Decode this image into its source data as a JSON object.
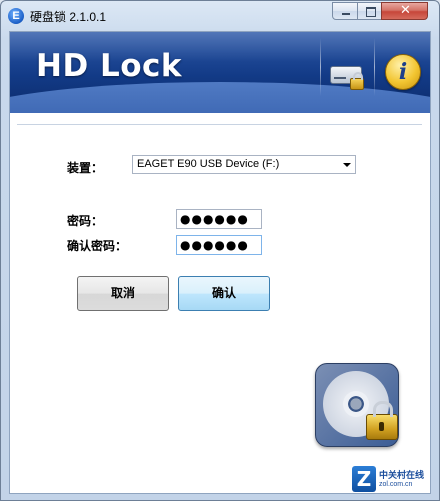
{
  "window": {
    "title": "硬盘锁 2.1.0.1",
    "app_icon_glyph": "E",
    "controls": {
      "close_glyph": "✕"
    }
  },
  "banner": {
    "logo": "HD Lock",
    "icons": [
      "hdd-lock-icon",
      "info-icon"
    ]
  },
  "form": {
    "device_label": "装置：",
    "device_value": "EAGET E90 USB Device (F:)",
    "password_label": "密码：",
    "password_value": "●●●●●●",
    "confirm_label": "确认密码：",
    "confirm_value": "●●●●●●",
    "cancel_button": "取消",
    "ok_button": "确认"
  },
  "watermark": {
    "glyph": "Z",
    "text": "中关村在线",
    "sub": "zol.com.cn"
  },
  "colors": {
    "banner": "#123a86",
    "ok_button": "#bee6fd",
    "close_button": "#c7463a"
  }
}
